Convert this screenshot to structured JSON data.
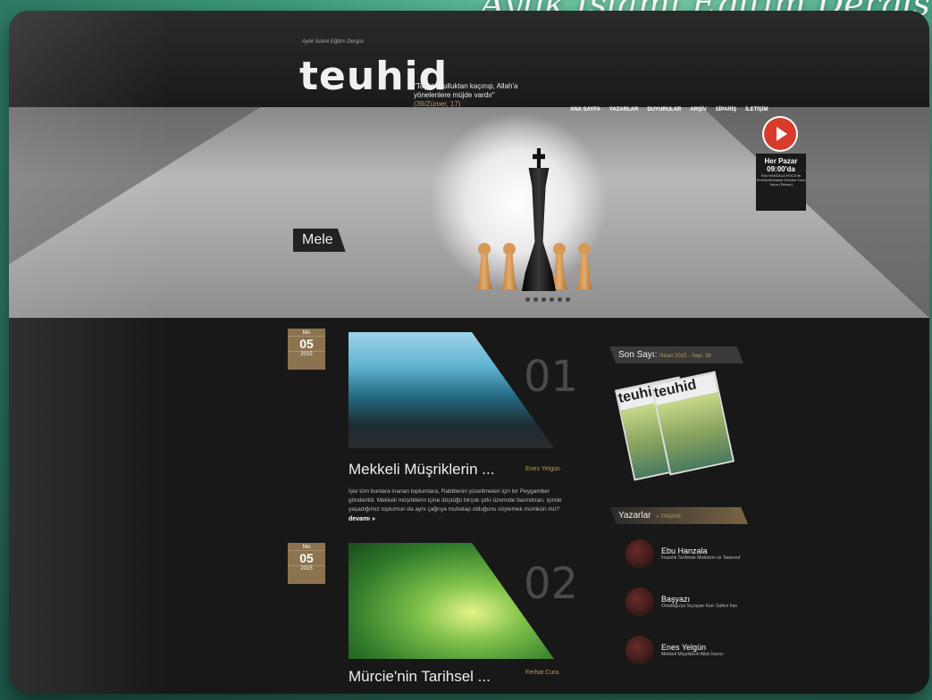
{
  "header": {
    "brand_small": "Aylık İslami Eğitim Dergisi",
    "logo": "teuhid",
    "tagline": "\"Tağuta kulluktan kaçınıp, Allah'a yönelenlere müjde vardır\"",
    "tagline_ref": "(39/Zümer, 17)",
    "banner_title": "Aylık İslami Eğitim Dergisi"
  },
  "nav": {
    "items": [
      "ANA SAYFA",
      "YAZARLAR",
      "DUYURULAR",
      "ARŞİV",
      "SİPARİŞ",
      "İLETİŞİM"
    ]
  },
  "hero": {
    "label": "Mele"
  },
  "live": {
    "day": "Her Pazar",
    "time": "09:00'da",
    "desc": "Ebu HANZALA HOCA ile Tevhidi Müdafasi Dersleri Canlı Yayın (Tekrarı)"
  },
  "posts": [
    {
      "month": "Nis",
      "day": "05",
      "year": "2015",
      "num": "01",
      "title": "Mekkeli Müşriklerin ...",
      "author": "Enes Yelgün",
      "excerpt": "İşte tüm bunlara inanan toplumlara, Rabblerini yüceltmeleri için bir Peygamber gönderildi. Mekkeli müşriklerin içine düştüğü birçok şirki üzerinde barındıran, içinde yaşadığımız toplumun da aynı çağrıya muhatap olduğunu söylemek mümkün mü?",
      "more": "devamı »"
    },
    {
      "month": "Nis",
      "day": "05",
      "year": "2015",
      "num": "02",
      "title": "Mürcie'nin Tarihsel ...",
      "author": "Ferhat Cura"
    }
  ],
  "sidebar": {
    "last_issue_label": "Son Sayı:",
    "last_issue_value": "Nisan 2015 - Sayı: 38",
    "authors_label": "Yazarlar",
    "authors_all": "» TAMAMI",
    "authors": [
      {
        "name": "Ebu Hanzala",
        "title": "İnsanlık Tarihinde Mistisizm ve Tasavvuf"
      },
      {
        "name": "Başyazı",
        "title": "Ortadoğu'ya Sıçrayan Kan: Safevi İran"
      },
      {
        "name": "Enes Yelgün",
        "title": "Mekkeli Müşriklerin Allah İnancı"
      }
    ]
  }
}
